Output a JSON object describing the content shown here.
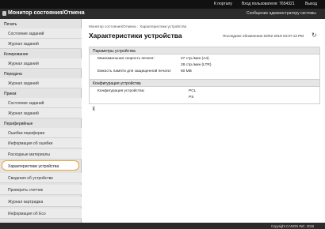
{
  "topbar": {
    "portal_link": "К порталу",
    "login_label": "Вход пользователя:",
    "login_user": "7654321",
    "logout_link": "Выход"
  },
  "app": {
    "title": "Монитор состояния/Отмена",
    "mail_to_admin": "Сообщение администратору системы"
  },
  "sidebar": {
    "sections": [
      {
        "label": "Печать",
        "items": [
          "Состояние заданий",
          "Журнал заданий"
        ]
      },
      {
        "label": "Копирование",
        "items": [
          "Журнал заданий"
        ]
      },
      {
        "label": "Передача",
        "items": [
          "Журнал заданий"
        ]
      },
      {
        "label": "Прием",
        "items": [
          "Состояние заданий",
          "Журнал заданий"
        ]
      },
      {
        "label": "Периферийные",
        "items": []
      },
      {
        "label": "Устройство",
        "items": [
          "Ошибки периферии",
          "Информация об ошибке",
          "Расходные материалы",
          "Характеристики устройства",
          "Сведения об устройстве",
          "Проверить счетчик",
          "Журнал картриджа",
          "Информация об Eco"
        ]
      }
    ]
  },
  "main": {
    "breadcrumb": [
      "Монитор состояния/Отмена",
      "Характеристики устройства"
    ],
    "page_title": "Характеристики устройства",
    "last_updated": "Последнее обновление 02/02 2019 04:07:13 PM",
    "specs_panel": {
      "title": "Параметры устройства",
      "max_speed_label": "Максимальная скорость печати:",
      "max_speed_a4": "27 стр./мин  (A4)",
      "max_speed_ltr": "28 стр./мин  (LTR)",
      "memory_label": "Емкость памяти для защищенной печати:",
      "memory_value": "60 MB"
    },
    "config_panel": {
      "title": "Конфигурация устройства",
      "config_label": "Конфигурация устройства:",
      "config_values": [
        "PCL",
        "PS"
      ]
    }
  },
  "footer": {
    "copyright": "Copyright CANON INC. 2016"
  }
}
